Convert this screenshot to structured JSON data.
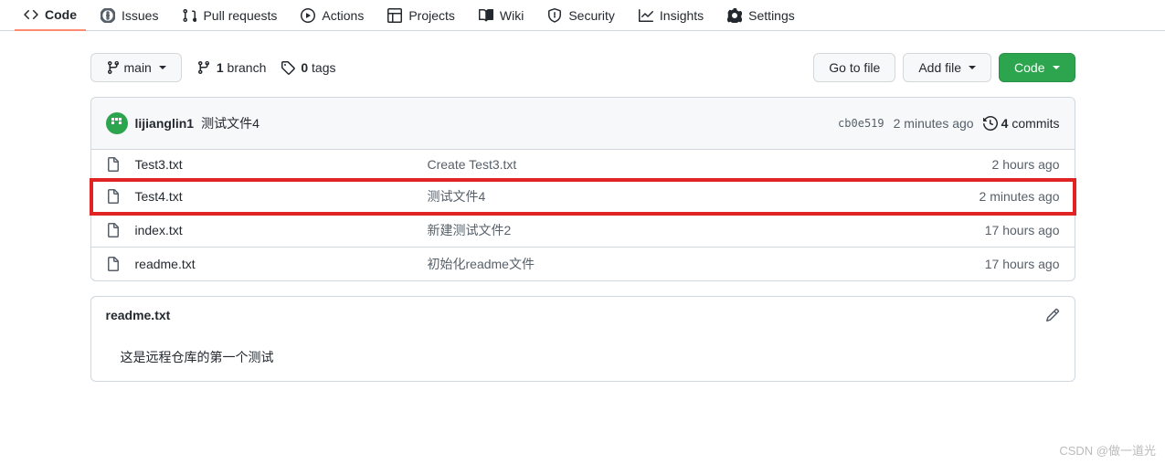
{
  "tabs": [
    {
      "label": "Code"
    },
    {
      "label": "Issues"
    },
    {
      "label": "Pull requests"
    },
    {
      "label": "Actions"
    },
    {
      "label": "Projects"
    },
    {
      "label": "Wiki"
    },
    {
      "label": "Security"
    },
    {
      "label": "Insights"
    },
    {
      "label": "Settings"
    }
  ],
  "branch_btn": "main",
  "branch_count": "1",
  "branch_count_label": "branch",
  "tag_count": "0",
  "tag_count_label": "tags",
  "toolbar": {
    "goto_file": "Go to file",
    "add_file": "Add file",
    "code": "Code"
  },
  "latest": {
    "author": "lijianglin1",
    "message": "测试文件4",
    "sha": "cb0e519",
    "time": "2 minutes ago",
    "commits_count": "4",
    "commits_label": "commits"
  },
  "files": [
    {
      "name": "Test3.txt",
      "msg": "Create Test3.txt",
      "time": "2 hours ago",
      "hl": false
    },
    {
      "name": "Test4.txt",
      "msg": "测试文件4",
      "time": "2 minutes ago",
      "hl": true
    },
    {
      "name": "index.txt",
      "msg": "新建测试文件2",
      "time": "17 hours ago",
      "hl": false
    },
    {
      "name": "readme.txt",
      "msg": "初始化readme文件",
      "time": "17 hours ago",
      "hl": false
    }
  ],
  "readme": {
    "title": "readme.txt",
    "body": "这是远程仓库的第一个测试"
  },
  "watermark": "CSDN @做一道光"
}
